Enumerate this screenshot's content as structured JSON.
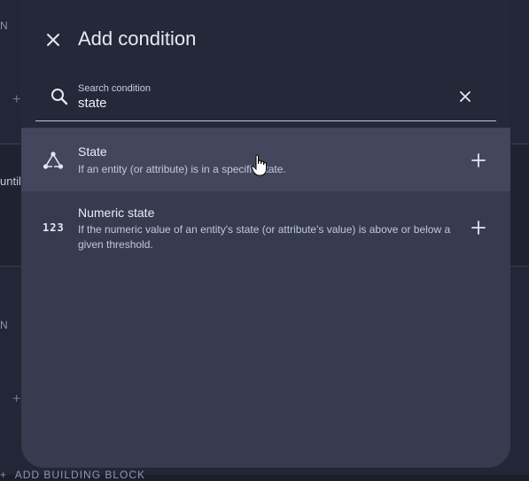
{
  "background": {
    "until_text": "until",
    "add_building_block": "ADD BUILDING BLOCK",
    "n_letter": "N"
  },
  "dialog": {
    "title": "Add condition",
    "search": {
      "label": "Search condition",
      "value": "state"
    },
    "items": [
      {
        "title": "State",
        "description": "If an entity (or attribute) is in a specific state.",
        "icon": "state-graph-icon"
      },
      {
        "title": "Numeric state",
        "description": "If the numeric value of an entity's state (or attribute's value) is above or below a given threshold.",
        "icon": "numeric-icon",
        "icon_text": "123"
      }
    ]
  },
  "colors": {
    "dialog_bg": "#363b50",
    "header_bg": "#252838",
    "highlight": "#43475d"
  }
}
